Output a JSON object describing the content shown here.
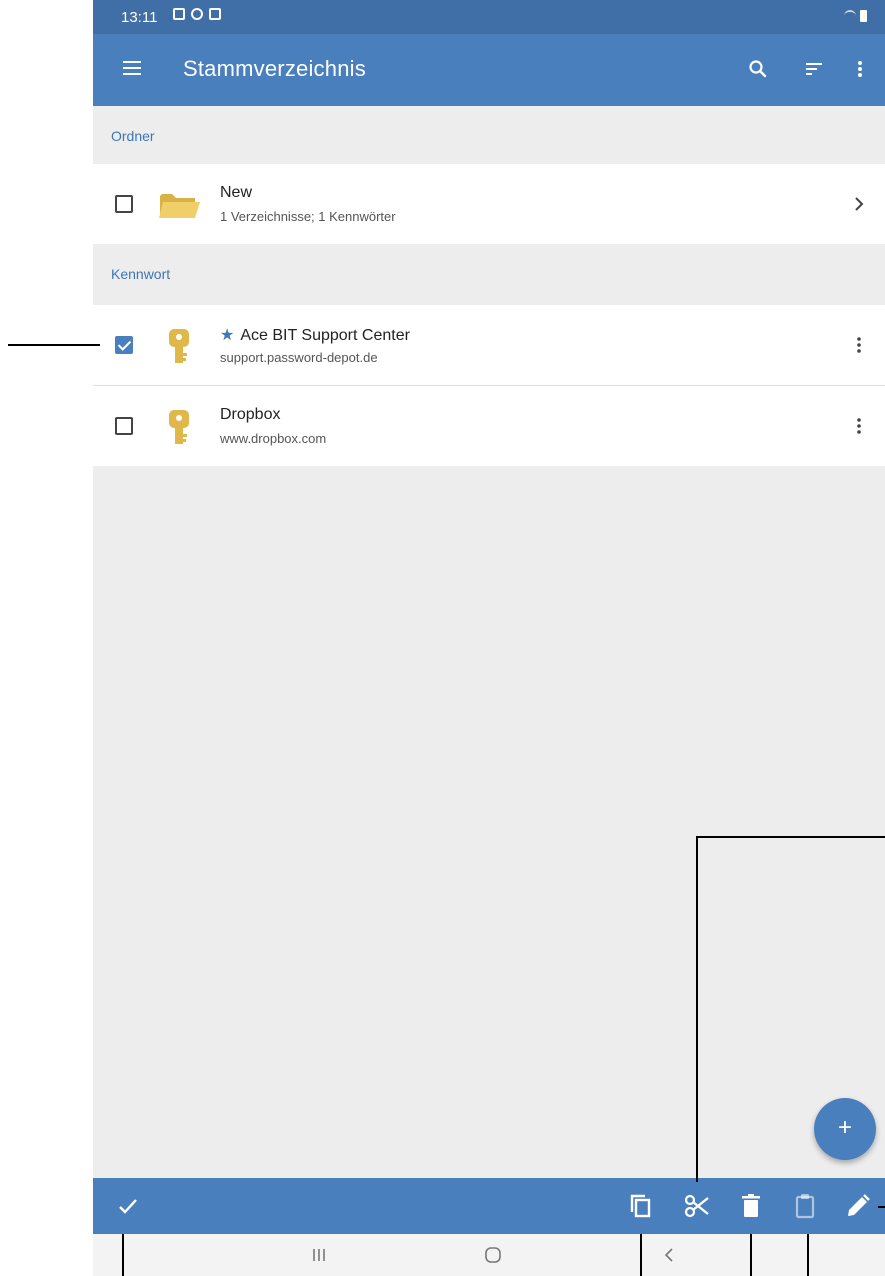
{
  "status_bar": {
    "time": "13:11"
  },
  "app_bar": {
    "title": "Stammverzeichnis"
  },
  "sections": {
    "folders": {
      "label": "Ordner"
    },
    "passwords": {
      "label": "Kennwort"
    }
  },
  "folders": [
    {
      "title": "New",
      "subtitle": "1 Verzeichnisse; 1 Kennwörter",
      "checked": false
    }
  ],
  "passwords": [
    {
      "title": "Ace BIT Support Center",
      "subtitle": "support.password-depot.de",
      "favorite": true,
      "checked": true
    },
    {
      "title": "Dropbox",
      "subtitle": "www.dropbox.com",
      "favorite": false,
      "checked": false
    }
  ],
  "fab": {
    "label": "+"
  },
  "icons": {
    "menu": "menu-icon",
    "search": "search-icon",
    "sort": "sort-icon",
    "more": "more-vert-icon",
    "folder": "folder-icon",
    "key": "key-icon",
    "chevron": "chevron-right-icon",
    "done": "check-icon",
    "copy": "copy-icon",
    "cut": "scissors-icon",
    "delete": "trash-icon",
    "paste": "clipboard-icon",
    "edit": "pencil-icon"
  },
  "colors": {
    "primary": "#4a7fbe",
    "status_bar": "#3f6fa6",
    "accent_text": "#3c77b8",
    "folder": "#e8c55a",
    "key": "#e0b84a"
  }
}
